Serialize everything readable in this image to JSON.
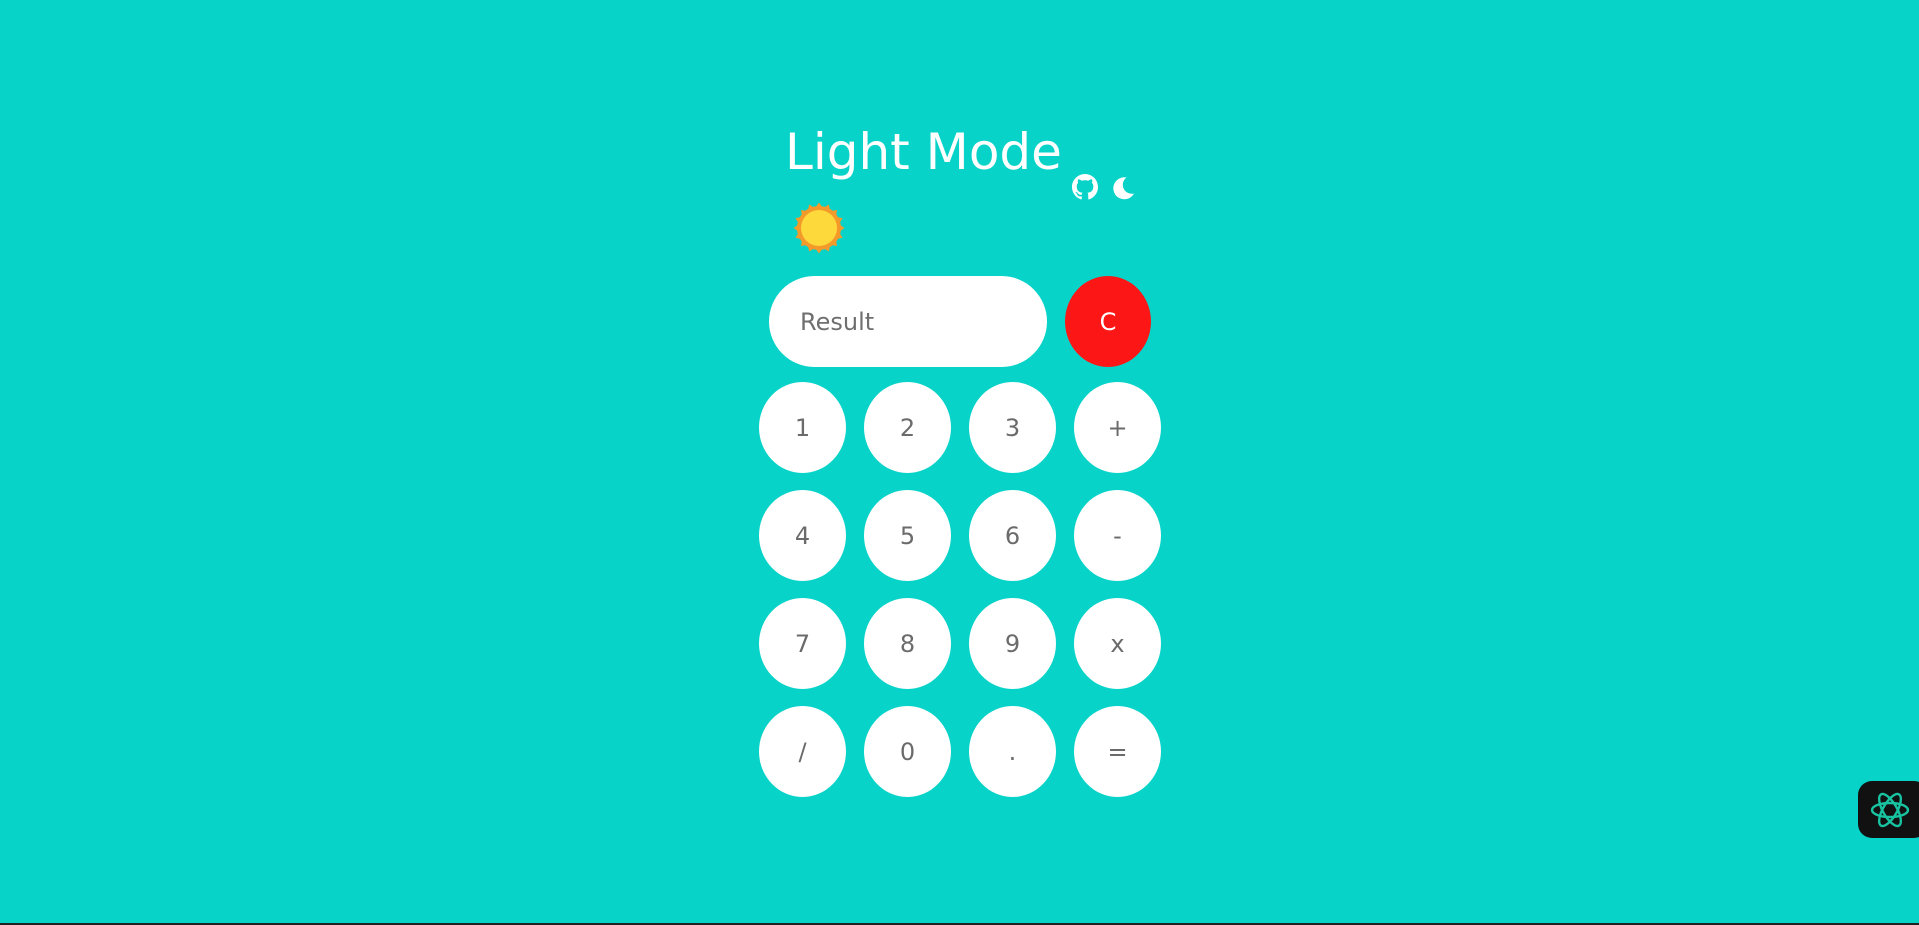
{
  "header": {
    "title": "Light Mode"
  },
  "display": {
    "placeholder": "Result",
    "value": "",
    "clear_label": "C"
  },
  "keypad": {
    "keys": [
      "1",
      "2",
      "3",
      "+",
      "4",
      "5",
      "6",
      "-",
      "7",
      "8",
      "9",
      "x",
      "/",
      "0",
      ".",
      "="
    ]
  },
  "icons": {
    "github": "github-icon",
    "theme_toggle": "moon-icon",
    "mode_indicator": "sun-icon",
    "assistant": "atom-icon"
  },
  "colors": {
    "background": "#07d3c8",
    "key_background": "#ffffff",
    "key_text": "#6b6b6b",
    "clear_button": "#fc1616",
    "sun_fill": "#fdd93b",
    "sun_rays": "#f39a2b",
    "assistant_bg": "#111111",
    "assistant_icon": "#17c3a0"
  }
}
